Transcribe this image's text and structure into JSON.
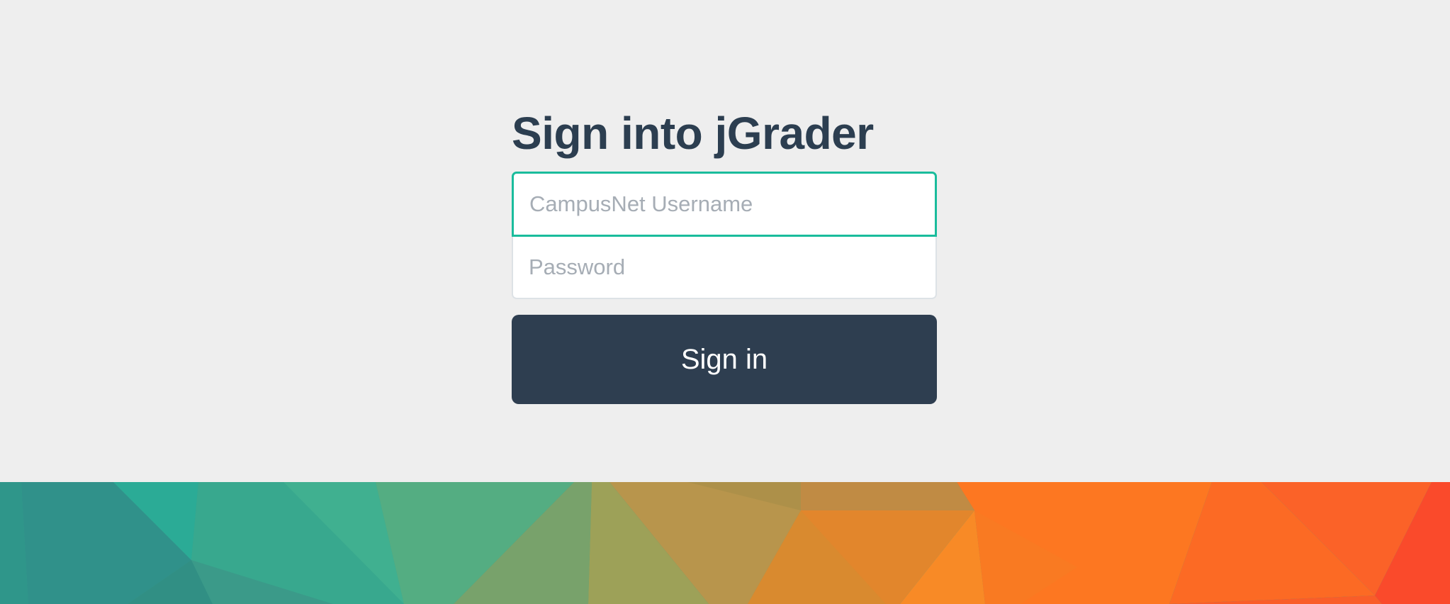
{
  "login": {
    "title": "Sign into jGrader",
    "username_placeholder": "CampusNet Username",
    "password_placeholder": "Password",
    "submit_label": "Sign in"
  },
  "colors": {
    "background": "#eeeeee",
    "heading": "#2c3e50",
    "focus_border": "#1abc9c",
    "button": "#2e3e50"
  }
}
